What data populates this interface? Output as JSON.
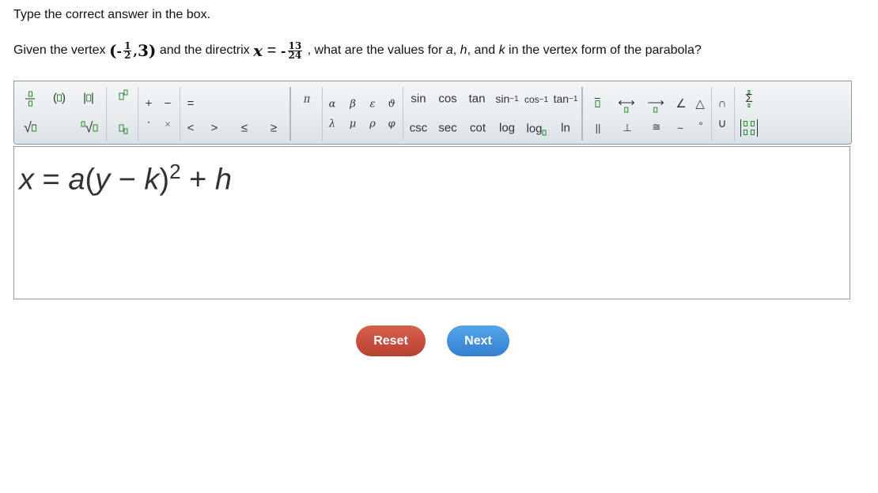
{
  "instruction": "Type the correct answer in the box.",
  "question": {
    "prefix": "Given the vertex ",
    "vertex_open": "(",
    "vertex_x_sign": "-",
    "vertex_x_num": "1",
    "vertex_x_den": "2",
    "vertex_sep": ",",
    "vertex_y": "3",
    "vertex_close": ")",
    "mid": " and the directrix ",
    "dir_var": "x",
    "dir_eq": " = ",
    "dir_sign": "-",
    "dir_num": "13",
    "dir_den": "24",
    "suffix": " , what are the values for ",
    "a": "a",
    ", ": ", ",
    "h": "h",
    "and": ", and ",
    "k": "k",
    "end": " in the vertex form of the parabola?"
  },
  "toolbar": {
    "plus": "+",
    "minus": "−",
    "dot": "·",
    "times": "×",
    "eq": "=",
    "lt": "<",
    "gt": ">",
    "le": "≤",
    "ge": "≥",
    "pi": "π",
    "greek": [
      "α",
      "β",
      "ε",
      "ϑ",
      "λ",
      "μ",
      "ρ",
      "φ"
    ],
    "trig_top": [
      "sin",
      "cos",
      "tan"
    ],
    "inv": [
      "sin",
      "cos",
      "tan"
    ],
    "inv_exp": "−1",
    "trig_bottom": [
      "csc",
      "sec",
      "cot",
      "log",
      "log",
      "ln"
    ],
    "arrow_line": "⟷",
    "arrow_ray": "⟶",
    "angle": "∠",
    "triangle": "△",
    "parallel": "||",
    "perp": "⊥",
    "congruent": "≅",
    "similar": "~",
    "degree": "°",
    "cap": "∩",
    "cup": "∪",
    "sigma": "Σ"
  },
  "answer": {
    "x": "x",
    "eq": " = ",
    "a": "a",
    "lp": "(",
    "y": "y",
    "minus": " − ",
    "k": "k",
    "rp": ")",
    "exp": "2",
    "plus": " + ",
    "h": "h"
  },
  "buttons": {
    "reset": "Reset",
    "next": "Next"
  },
  "colors": {
    "placeholder": "#2a8a2a",
    "reset": "#c94c3a",
    "next": "#3d8cdb"
  }
}
